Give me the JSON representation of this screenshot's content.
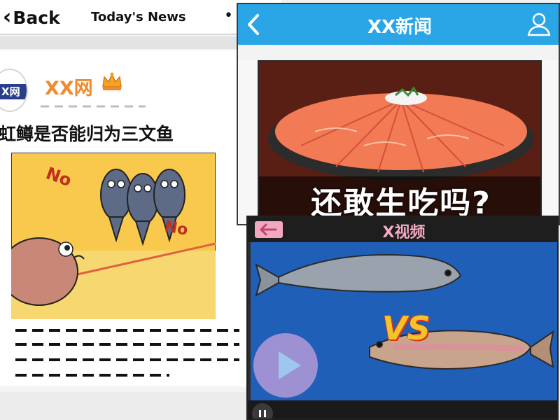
{
  "back_phone": {
    "back_label": "Back",
    "title": "Today's News",
    "more_menu": "•",
    "source_name": "XX网",
    "avatar_text": "X网",
    "headline": "虹鳟是否能归为三文鱼",
    "comic_text_1": "No",
    "comic_text_2": "No",
    "icons": {
      "back": "chevron-left-icon",
      "crown": "crown-icon"
    }
  },
  "news_app": {
    "title": "XX新闻",
    "caption": "还敢生吃吗?",
    "icons": {
      "back": "chevron-left-icon",
      "user": "user-icon"
    },
    "colors": {
      "bar": "#2aa6e6"
    }
  },
  "video_app": {
    "title": "X视频",
    "vs_text": "VS",
    "icons": {
      "back": "arrow-left-icon",
      "play": "play-icon",
      "pause": "pause-icon"
    },
    "colors": {
      "title": "#f4a9c4",
      "video_bg": "#1f5fb8"
    }
  }
}
